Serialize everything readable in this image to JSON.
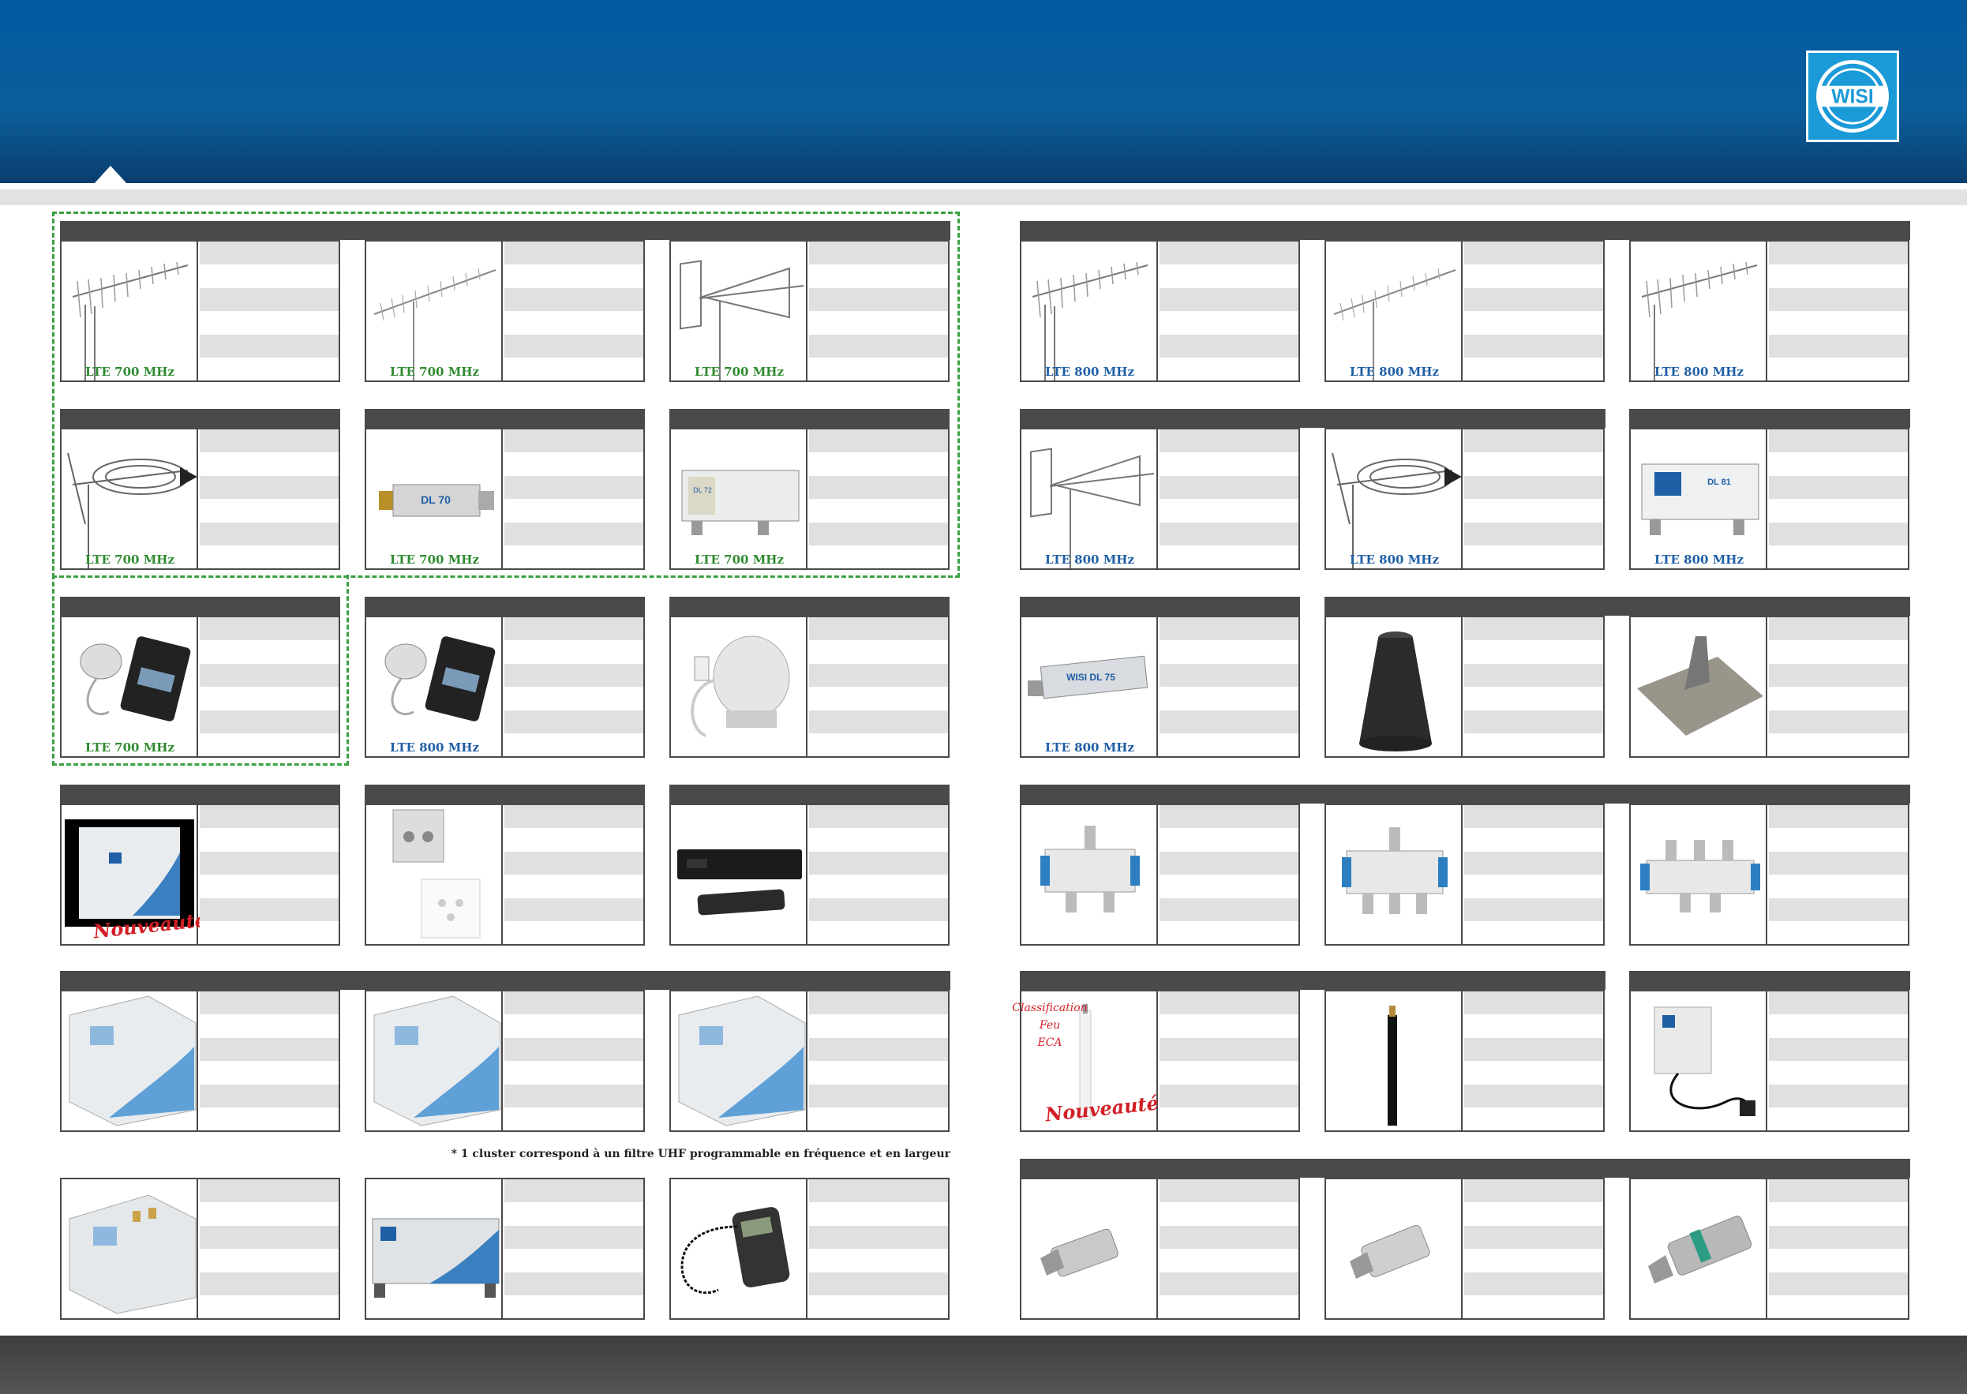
{
  "labels": {
    "lte700": "LTE 700 MHz",
    "lte800": "LTE 800 MHz",
    "nouveaute": "Nouveauté",
    "classification": "Classification",
    "feu": "Feu",
    "eca": "ECA"
  },
  "footnote": "* 1 cluster correspond à un filtre UHF programmable en fréquence et en largeur",
  "colors": {
    "banner": "#015aa0",
    "lte700": "#2e8a2e",
    "lte800": "#1f5fa6",
    "nouveaute": "#d21f26",
    "logo": "#1b9ad8",
    "dashed_frame": "#3aa041"
  },
  "icons": [
    "wisi-logo",
    "yagi-antenna-icon",
    "logperiodic-antenna-icon",
    "lte-filter-icon",
    "power-supply-icon",
    "amplifier-icon",
    "wall-socket-icon",
    "set-top-box-icon",
    "splitter-icon",
    "coax-cable-icon",
    "f-connector-icon",
    "roof-tile-icon",
    "cone-icon",
    "handheld-programmer-icon"
  ]
}
